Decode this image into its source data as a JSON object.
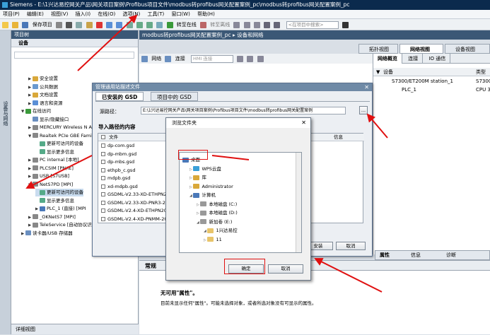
{
  "window": {
    "title": "Siemens - E:\\1兴达易控网关产品\\网关项目案例\\Profibus项目文件\\modbus转profibus网关配置案例_pc\\modbus转profibus网关配置案例_pc"
  },
  "menu": [
    "项目(P)",
    "编辑(E)",
    "视图(V)",
    "插入(I)",
    "在线(O)",
    "选项(N)",
    "工具(T)",
    "窗口(W)",
    "帮助(H)"
  ],
  "toolbar": {
    "save_label": "保存项目",
    "go_online": "转至在线",
    "go_offline": "转至离线",
    "search_placeholder": "<在项目中搜索>"
  },
  "left": {
    "vertical_tab": "设备与网络",
    "panel_title": "项目树",
    "devices_header": "设备",
    "footer": "详细视图"
  },
  "tree": [
    {
      "label": "安全设置",
      "indent": 1,
      "arrow": "▶"
    },
    {
      "label": "公共数据",
      "indent": 1,
      "arrow": "▶"
    },
    {
      "label": "文档设置",
      "indent": 1,
      "arrow": "▶"
    },
    {
      "label": "语言和资源",
      "indent": 1,
      "arrow": "▶"
    },
    {
      "label": "在线访问",
      "indent": 0,
      "arrow": "▼"
    },
    {
      "label": "显示/隐藏接口",
      "indent": 1,
      "arrow": ""
    },
    {
      "label": "MERCURY Wireless N Ad",
      "indent": 1,
      "arrow": "▶"
    },
    {
      "label": "Realtek PCIe GBE Family",
      "indent": 1,
      "arrow": "▼"
    },
    {
      "label": "更新可访问的设备",
      "indent": 2,
      "arrow": ""
    },
    {
      "label": "显示更多信息",
      "indent": 2,
      "arrow": ""
    },
    {
      "label": "PC internal [本地]",
      "indent": 1,
      "arrow": "▶"
    },
    {
      "label": "PLCSIM [PN/IE]",
      "indent": 1,
      "arrow": "▶"
    },
    {
      "label": "USB [S7USB]",
      "indent": 1,
      "arrow": "▶"
    },
    {
      "label": "NetS7PD [MPI]",
      "indent": 1,
      "arrow": "▼"
    },
    {
      "label": "更新可访问的设备",
      "indent": 2,
      "arrow": ""
    },
    {
      "label": "显示更多信息",
      "indent": 2,
      "arrow": ""
    },
    {
      "label": "PLC_1 (直接) [MPI",
      "indent": 2,
      "arrow": "▶"
    },
    {
      "label": "_OKNetS7 [MPI]",
      "indent": 1,
      "arrow": "▶"
    },
    {
      "label": "TeleService [自动协议识",
      "indent": 1,
      "arrow": "▶"
    },
    {
      "label": "读卡器/USB 存储器",
      "indent": 0,
      "arrow": "▶"
    }
  ],
  "main": {
    "header": "modbus转profibus网关配置案例_pc ▸ 设备和网络",
    "view_tabs": [
      "拓扑视图",
      "网络视图",
      "设备视图"
    ],
    "net_toolbar": {
      "network": "网络",
      "connect": "连接",
      "hmi": "HMI 连接"
    }
  },
  "right": {
    "tabs": [
      "网络概览",
      "连接",
      "IO 通信"
    ],
    "col_device": "设备",
    "col_type": "类型",
    "rows": [
      {
        "device": "S7300/ET200M station_1",
        "type": "S7300"
      },
      {
        "device": "PLC_1",
        "type": "CPU 3"
      }
    ]
  },
  "props": {
    "tabs": [
      "常规"
    ],
    "right_tabs": [
      "属性",
      "信息",
      "诊断"
    ],
    "title": "无可用\"属性\"。",
    "desc": "目前未显示任何\"属性\"。可能未选择对象，或者所选对象没有可显示的属性。"
  },
  "gsd": {
    "title": "管理通用站描述文件",
    "tab_installed": "已安装的 GSD",
    "tab_project": "项目中的 GSD",
    "source_label": "源路径：",
    "source_path": "E:\\1兴达易控网关产品\\网关项目案例\\Profibus项目文件\\modbus转profibus网关配置案例",
    "browse": "...",
    "content_label": "导入路径的内容",
    "col_file": "文件",
    "col_info": "信息",
    "files": [
      "dp-com.gsd",
      "dp-mbm.gsd",
      "dp-mbs.gsd",
      "ethpb_c.gsd",
      "mdpb.gsd",
      "xd-mdpb.gsd",
      "GSDML-V2.33-XD-ETHPN2",
      "GSDML-V2.33-XD-PNR3-20",
      "GSDML-V2.4-XD-ETHPN20",
      "GSDML-V2.4-XD-PNMM-20"
    ],
    "install": "安装",
    "cancel": "取消"
  },
  "folder": {
    "title": "浏览文件夹",
    "items": [
      {
        "label": "桌面",
        "indent": 0
      },
      {
        "label": "WPS云盘",
        "indent": 1
      },
      {
        "label": "库",
        "indent": 1
      },
      {
        "label": "Administrator",
        "indent": 1
      },
      {
        "label": "计算机",
        "indent": 1
      },
      {
        "label": "本地磁盘 (C:)",
        "indent": 2
      },
      {
        "label": "本地磁盘 (D:)",
        "indent": 2
      },
      {
        "label": "新加卷 (E:)",
        "indent": 2
      },
      {
        "label": "1兴达易控",
        "indent": 3
      },
      {
        "label": "11",
        "indent": 3
      }
    ],
    "ok": "确定",
    "cancel": "取消"
  },
  "colors": {
    "accent": "#e01010",
    "title_bg": "#0b2a4d",
    "panel_hdr": "#3b5876"
  }
}
